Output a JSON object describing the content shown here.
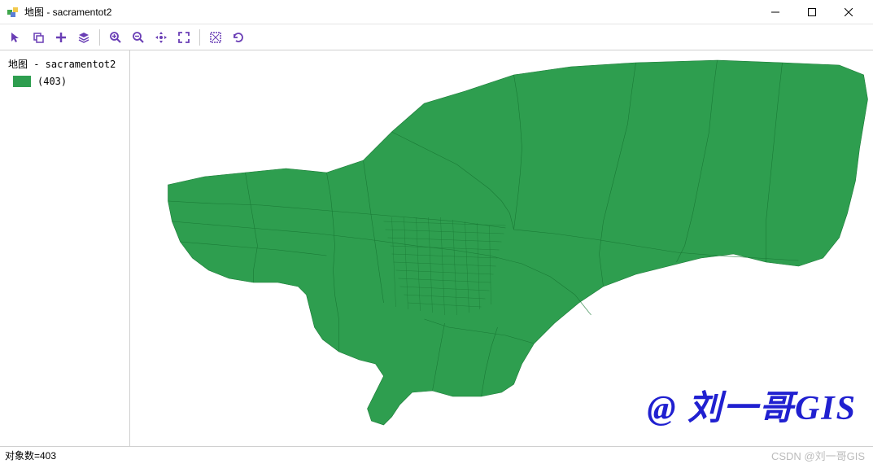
{
  "window": {
    "title": "地图 - sacramentot2"
  },
  "sidebar": {
    "layer_title": "地图 - sacramentot2",
    "legend_label": "(403)",
    "swatch_color": "#2e9e4f"
  },
  "map": {
    "watermark": "@ 刘一哥GIS"
  },
  "statusbar": {
    "objects": "对象数=403",
    "csdn": "CSDN @刘一哥GIS"
  },
  "icons": {
    "arrow": "arrow-icon",
    "copy": "copy-icon",
    "plus": "plus-icon",
    "layers": "layers-icon",
    "zoom_in": "zoom-in-icon",
    "zoom_out": "zoom-out-icon",
    "pan": "pan-icon",
    "extent": "full-extent-icon",
    "select_rect": "select-rect-icon",
    "refresh": "refresh-icon"
  }
}
